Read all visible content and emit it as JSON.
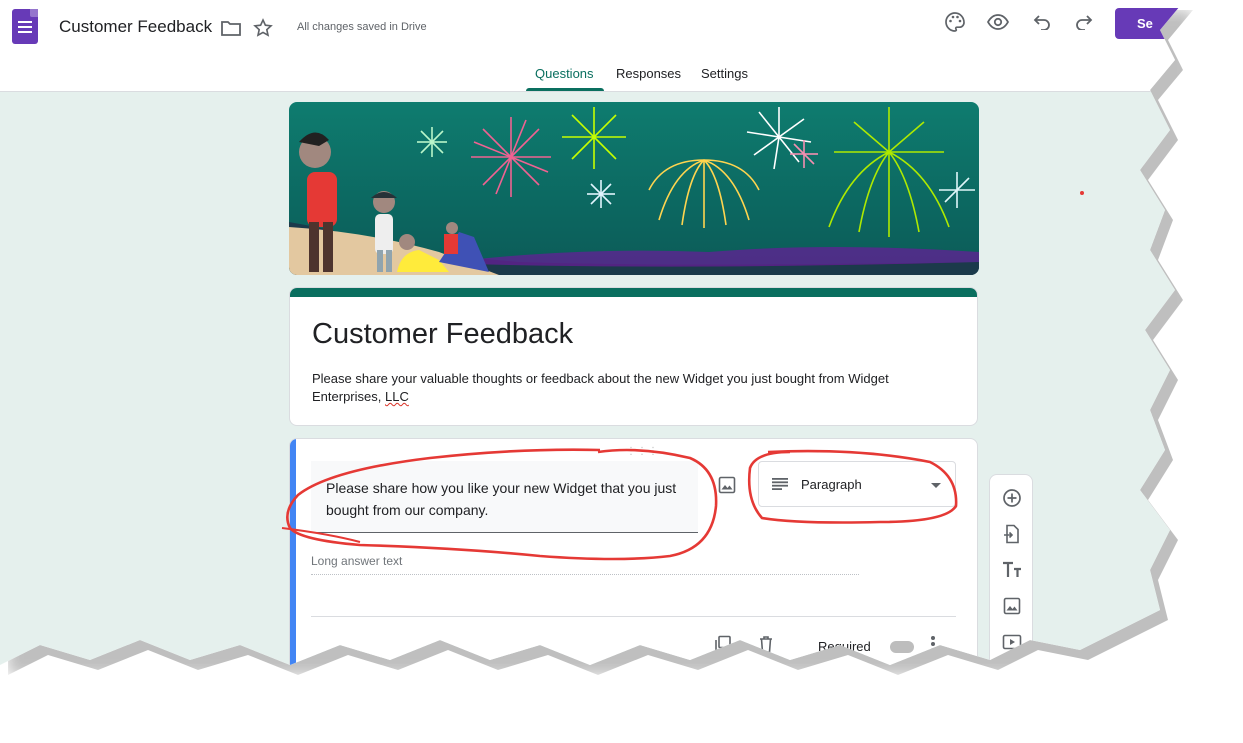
{
  "header": {
    "doc_title": "Customer Feedback",
    "save_status": "All changes saved in Drive",
    "send_label": "Se",
    "icons": [
      "forms-logo-icon",
      "folder-icon",
      "star-icon",
      "palette-icon",
      "preview-eye-icon",
      "undo-icon",
      "redo-icon"
    ]
  },
  "tabs": [
    {
      "label": "Questions",
      "active": true
    },
    {
      "label": "Responses",
      "active": false
    },
    {
      "label": "Settings",
      "active": false
    }
  ],
  "form": {
    "title": "Customer Feedback",
    "description_main": "Please share your valuable thoughts or feedback about the new Widget you just bought from Widget Enterprises,",
    "description_tail": "LLC"
  },
  "question": {
    "text": "Please share how you like your new Widget that you just bought from our company.",
    "type": "Paragraph",
    "answer_placeholder": "Long answer text",
    "required_label": "Required"
  },
  "toolbar": {
    "items": [
      "add-question-icon",
      "import-questions-icon",
      "add-title-icon",
      "add-image-icon",
      "add-video-icon"
    ]
  },
  "colors": {
    "theme": "#0a6f5f",
    "background": "#e5f0ed",
    "accent_purple": "#673ab7",
    "question_bar": "#4285f4",
    "annotation": "#e53935"
  }
}
